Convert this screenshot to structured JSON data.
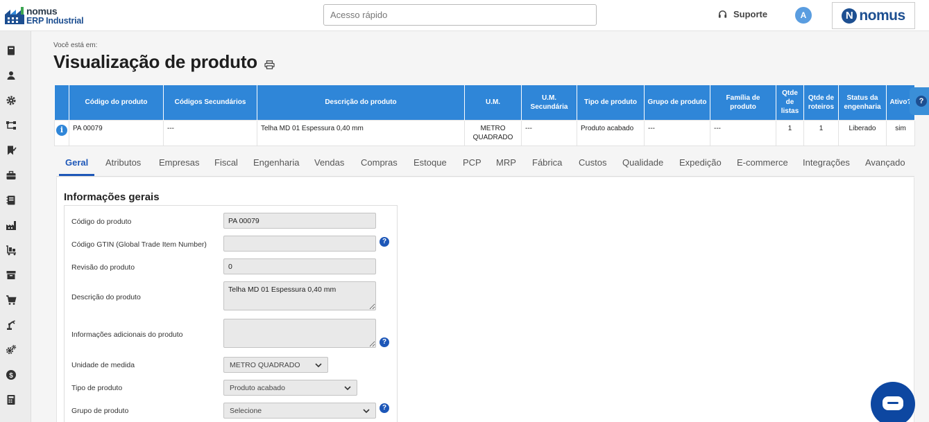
{
  "header": {
    "logo_line1": "nomus",
    "logo_line2": "ERP Industrial",
    "quick_placeholder": "Acesso rápido",
    "support_label": "Suporte",
    "avatar_initial": "A",
    "brand_letter": "N",
    "brand_word": "nomus"
  },
  "sidebar": {
    "icons": [
      "book-icon",
      "user-icon",
      "gear-icon",
      "flow-icon",
      "bookmark-icon",
      "briefcase-icon",
      "notebook-icon",
      "factory-icon",
      "cart-pallet-icon",
      "archive-icon",
      "cart-icon",
      "robot-arm-icon",
      "gears-icon",
      "dollar-icon",
      "calculator-icon"
    ]
  },
  "page": {
    "breadcrumb": "Você está em:",
    "title": "Visualização de produto"
  },
  "product_table": {
    "headers": [
      "Código do produto",
      "Códigos Secundários",
      "Descrição do produto",
      "U.M.",
      "U.M. Secundária",
      "Tipo de produto",
      "Grupo de produto",
      "Família de produto",
      "Qtde de listas",
      "Qtde de roteiros",
      "Status da engenharia",
      "Ativo?"
    ],
    "row": {
      "info": "i",
      "codigo": "PA 00079",
      "codigos_sec": "---",
      "descricao": "Telha MD 01 Espessura 0,40 mm",
      "um": "METRO QUADRADO",
      "um_sec": "---",
      "tipo": "Produto acabado",
      "grupo": "---",
      "familia": "---",
      "qtde_listas": "1",
      "qtde_roteiros": "1",
      "status": "Liberado",
      "ativo": "sim"
    }
  },
  "tabs": [
    "Geral",
    "Atributos",
    "Empresas",
    "Fiscal",
    "Engenharia",
    "Vendas",
    "Compras",
    "Estoque",
    "PCP",
    "MRP",
    "Fábrica",
    "Custos",
    "Qualidade",
    "Expedição",
    "E-commerce",
    "Integrações",
    "Avançado"
  ],
  "active_tab": "Geral",
  "form": {
    "section_title": "Informações gerais",
    "codigo_label": "Código do produto",
    "codigo_value": "PA 00079",
    "gtin_label": "Código GTIN (Global Trade Item Number)",
    "gtin_value": "",
    "revisao_label": "Revisão do produto",
    "revisao_value": "0",
    "descricao_label": "Descrição do produto",
    "descricao_value": "Telha MD 01 Espessura 0,40 mm",
    "info_adic_label": "Informações adicionais do produto",
    "info_adic_value": "",
    "unidade_label": "Unidade de medida",
    "unidade_value": "METRO QUADRADO",
    "tipo_label": "Tipo de produto",
    "tipo_value": "Produto acabado",
    "grupo_label": "Grupo de produto",
    "grupo_value": "Selecione",
    "help_glyph": "?"
  },
  "colors": {
    "table_header": "#2f86d8",
    "active_tab": "#1d57b8",
    "chat_button": "#0d47a1"
  }
}
